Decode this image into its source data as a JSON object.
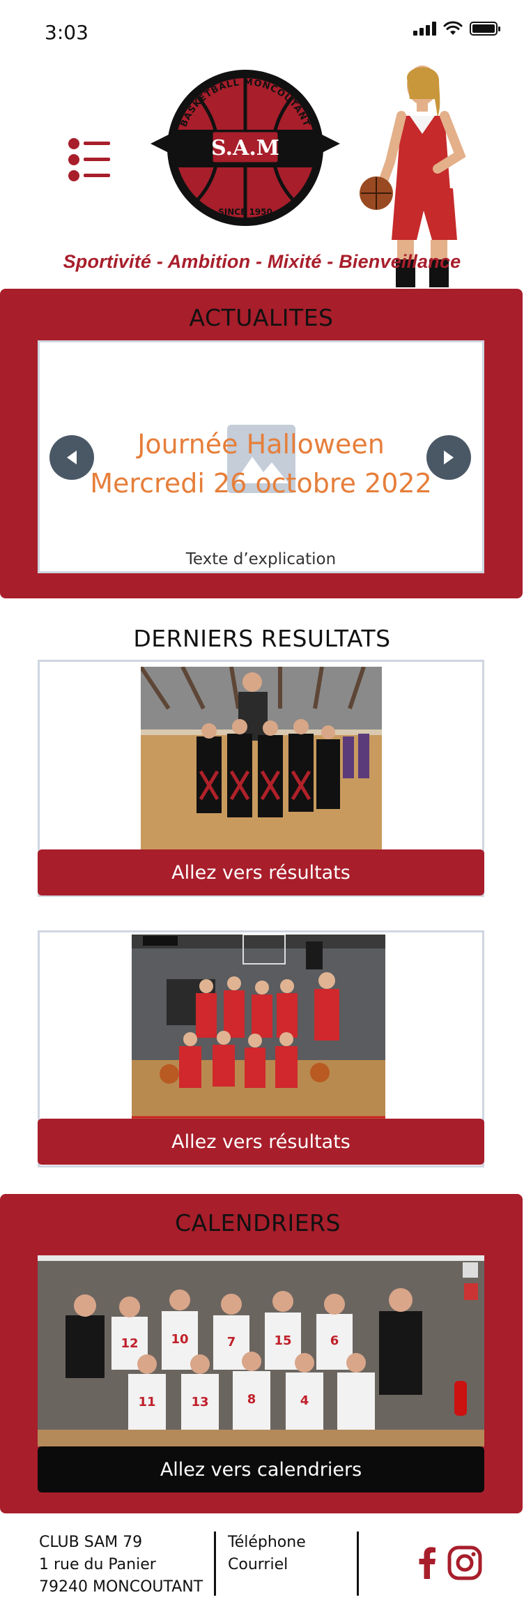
{
  "status_bar": {
    "time": "3:03"
  },
  "header": {
    "logo_top_text": "BASKETBALL MONCOUTANT",
    "logo_initials": "S.A.M",
    "logo_bottom_text": "SINCE 1950",
    "tagline": "Sportivité - Ambition - Mixité - Bienveillance"
  },
  "news": {
    "title": "ACTUALITES",
    "card_title_line1": "Journée Halloween",
    "card_title_line2": "Mercredi 26 octobre 2022",
    "card_description": "Texte d’explication"
  },
  "results": {
    "title": "DERNIERS RESULTATS",
    "items": [
      {
        "button_label": "Allez vers résultats"
      },
      {
        "button_label": "Allez vers résultats"
      }
    ]
  },
  "calendars": {
    "title": "CALENDRIERS",
    "button_label": "Allez vers calendriers"
  },
  "footer": {
    "club_name": "CLUB SAM 79",
    "address_line": "1 rue du Panier",
    "city_line": "79240 MONCOUTANT",
    "phone_label": "Téléphone",
    "email_label": "Courriel"
  },
  "colors": {
    "brand_red": "#a81e2b",
    "accent_orange": "#e67e3a",
    "dark": "#0b0b0b"
  }
}
